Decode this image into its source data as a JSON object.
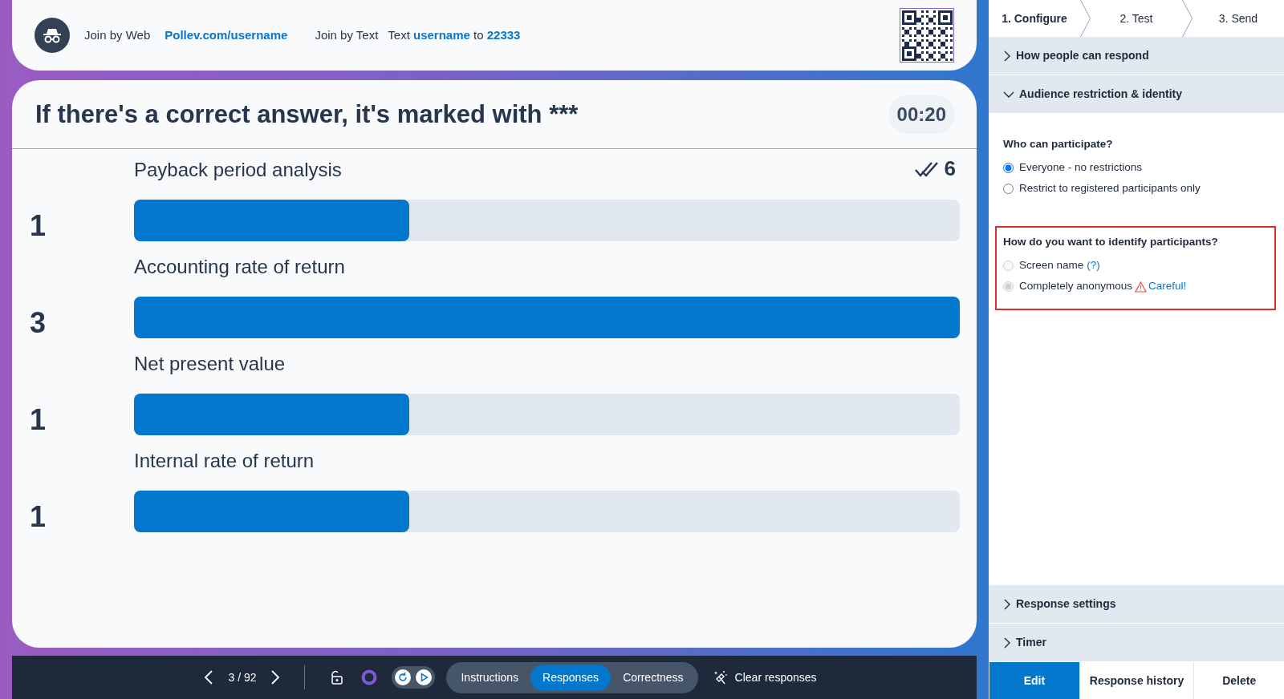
{
  "join_bar": {
    "web_label": "Join by Web",
    "web_link": "Pollev.com/username",
    "text_label": "Join by Text",
    "text_instruction": "Text **username** to **22333**"
  },
  "poll": {
    "title": "If there's a correct answer, it's marked with ***",
    "timer": "00:20",
    "response_count": "6",
    "answers": [
      {
        "label": "Payback period analysis",
        "count": "1",
        "level": 0.333
      },
      {
        "label": "Accounting rate of return",
        "count": "3",
        "level": 1.0
      },
      {
        "label": "Net present value",
        "count": "1",
        "level": 0.333
      },
      {
        "label": "Internal rate of return",
        "count": "1",
        "level": 0.333
      }
    ]
  },
  "toolbar": {
    "page": "3 / 92",
    "modes": [
      {
        "label": "Instructions",
        "selected": false
      },
      {
        "label": "Responses",
        "selected": true
      },
      {
        "label": "Correctness",
        "selected": false
      }
    ],
    "clear_label": "Clear responses"
  },
  "sidebar": {
    "steps": [
      {
        "label": "1. Configure",
        "selected": true
      },
      {
        "label": "2. Test",
        "selected": false
      },
      {
        "label": "3. Send",
        "selected": false
      }
    ],
    "sections_top": [
      {
        "title": "How people can respond",
        "expanded": false
      },
      {
        "title": "Audience restriction & identity",
        "expanded": true
      }
    ],
    "groups": [
      {
        "question": "Who can participate?",
        "highlighted": false,
        "options": [
          {
            "label": "Everyone - no restrictions",
            "selected": true,
            "disabled": false
          },
          {
            "label": "Restrict to registered participants only",
            "selected": false,
            "disabled": false
          }
        ]
      },
      {
        "question": "How do you want to identify participants?",
        "highlighted": true,
        "options": [
          {
            "label": "Screen name",
            "selected": false,
            "disabled": true,
            "help_link": "(?)"
          },
          {
            "label": "Completely anonymous",
            "selected": true,
            "disabled": true,
            "warning_link": "Careful!"
          }
        ]
      }
    ],
    "sections_bottom": [
      {
        "title": "Response settings",
        "expanded": false
      },
      {
        "title": "Timer",
        "expanded": false
      }
    ],
    "actions": [
      {
        "label": "Edit",
        "selected": true
      },
      {
        "label": "Response history",
        "selected": false
      },
      {
        "label": "Delete",
        "selected": false
      }
    ]
  }
}
